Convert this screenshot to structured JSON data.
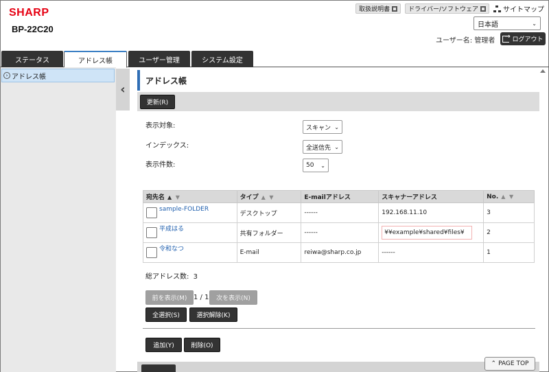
{
  "header": {
    "brand": "SHARP",
    "model": "BP-22C20",
    "links": [
      {
        "label": "取扱説明書"
      },
      {
        "label": "ドライバー/ソフトウェア"
      }
    ],
    "sitemap_label": "サイトマップ",
    "language": "日本語",
    "user_label": "ユーザー名: 管理者",
    "logout_label": "ログアウト"
  },
  "tabs": [
    {
      "label": "ステータス"
    },
    {
      "label": "アドレス帳"
    },
    {
      "label": "ユーザー管理"
    },
    {
      "label": "システム設定"
    }
  ],
  "sidebar": {
    "items": [
      {
        "label": "アドレス帳"
      }
    ]
  },
  "main": {
    "title": "アドレス帳",
    "refresh_label": "更新(R)",
    "filters": {
      "display_target": {
        "label": "表示対象:",
        "value": "スキャン"
      },
      "index": {
        "label": "インデックス:",
        "value": "全送信先"
      },
      "per_page": {
        "label": "表示件数:",
        "value": "50"
      }
    },
    "table": {
      "columns": [
        "宛先名",
        "タイプ",
        "E-mailアドレス",
        "スキャナーアドレス",
        "No."
      ],
      "rows": [
        {
          "name": "sample-FOLDER",
          "type": "デスクトップ",
          "email": "------",
          "scanner": "192.168.11.10",
          "no": "3"
        },
        {
          "name": "平成はる",
          "type": "共有フォルダー",
          "email": "------",
          "scanner": "¥¥example¥shared¥files¥",
          "no": "2"
        },
        {
          "name": "令和なつ",
          "type": "E-mail",
          "email": "reiwa@sharp.co.jp",
          "scanner": "------",
          "no": "1"
        }
      ]
    },
    "total_label": "総アドレス数:",
    "total_count": "3",
    "prev_label": "前を表示(M)",
    "page_indicator": "1 / 1",
    "next_label": "次を表示(N)",
    "select_all_label": "全選択(S)",
    "deselect_label": "選択解除(K)",
    "add_label": "追加(Y)",
    "delete_label": "削除(O)",
    "page_top_label": "PAGE TOP"
  }
}
